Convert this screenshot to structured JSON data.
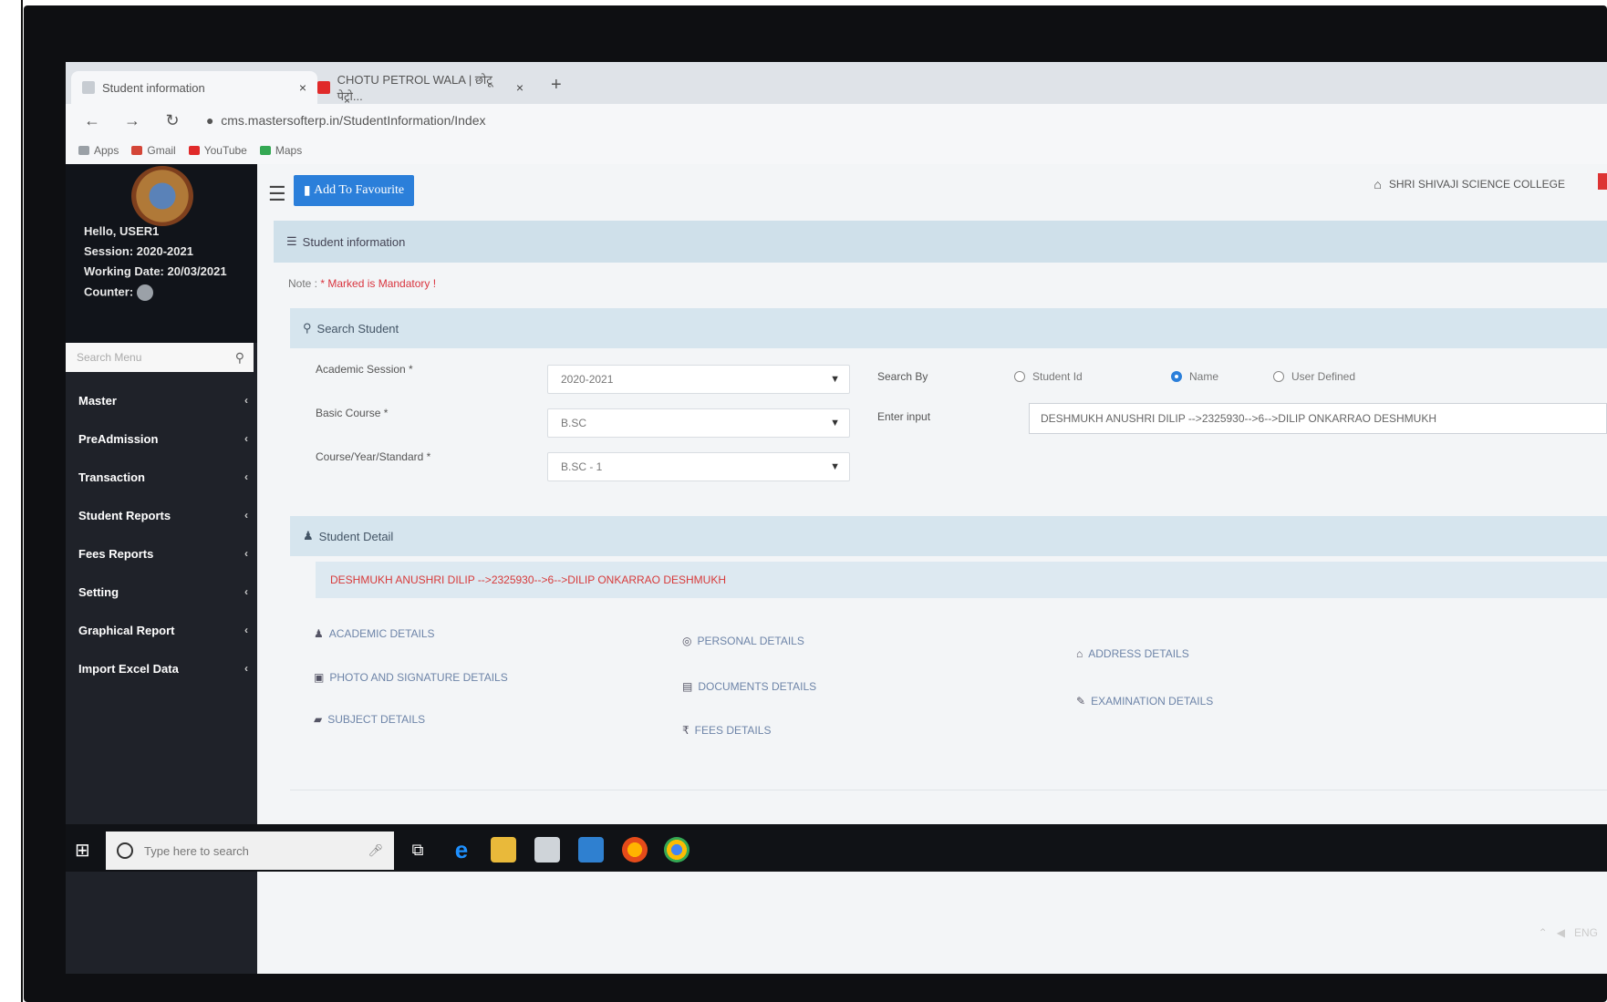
{
  "browser": {
    "tabs": [
      {
        "label": "Student information",
        "close": "×",
        "active": true
      },
      {
        "label": "CHOTU PETROL WALA | छोटू पेट्रो...",
        "close": "×",
        "active": false
      }
    ],
    "new_tab": "+",
    "url": "cms.mastersofterp.in/StudentInformation/Index",
    "bookmarks": [
      "Apps",
      "Gmail",
      "YouTube",
      "Maps"
    ]
  },
  "sidebar": {
    "greeting": "Hello, USER1",
    "session": "Session: 2020-2021",
    "working_date": "Working Date: 20/03/2021",
    "counter_label": "Counter:",
    "search_placeholder": "Search Menu",
    "menu": [
      {
        "label": "Master"
      },
      {
        "label": "PreAdmission"
      },
      {
        "label": "Transaction"
      },
      {
        "label": "Student Reports"
      },
      {
        "label": "Fees Reports"
      },
      {
        "label": "Setting"
      },
      {
        "label": "Graphical Report"
      },
      {
        "label": "Import Excel Data"
      }
    ]
  },
  "header": {
    "fav_button": "Add To Favourite",
    "college": "SHRI SHIVAJI SCIENCE COLLEGE"
  },
  "page": {
    "title": "Student information",
    "note_prefix": "Note : ",
    "note_required": "* Marked is Mandatory !"
  },
  "search": {
    "title": "Search Student",
    "academic_session_label": "Academic Session *",
    "academic_session_value": "2020-2021",
    "basic_course_label": "Basic Course *",
    "basic_course_value": "B.SC",
    "course_year_label": "Course/Year/Standard *",
    "course_year_value": "B.SC - 1",
    "search_by_label": "Search By",
    "radio_options": [
      {
        "label": "Student Id",
        "selected": false
      },
      {
        "label": "Name",
        "selected": true
      },
      {
        "label": "User Defined",
        "selected": false
      }
    ],
    "enter_input_label": "Enter input",
    "enter_input_value": "DESHMUKH ANUSHRI DILIP -->2325930-->6-->DILIP ONKARRAO DESHMUKH"
  },
  "detail": {
    "title": "Student Detail",
    "student_line": "DESHMUKH ANUSHRI DILIP -->2325930-->6-->DILIP ONKARRAO DESHMUKH",
    "links": {
      "academic": "ACADEMIC DETAILS",
      "personal": "PERSONAL DETAILS",
      "address": "ADDRESS DETAILS",
      "photo": "PHOTO AND SIGNATURE DETAILS",
      "documents": "DOCUMENTS DETAILS",
      "examination": "EXAMINATION DETAILS",
      "subject": "SUBJECT DETAILS",
      "fees": "FEES DETAILS"
    }
  },
  "taskbar": {
    "search_placeholder": "Type here to search",
    "tray_lang": "ENG"
  },
  "colors": {
    "primary": "#2b7fda",
    "sidebar": "#1f2229",
    "required": "#d9343e"
  }
}
